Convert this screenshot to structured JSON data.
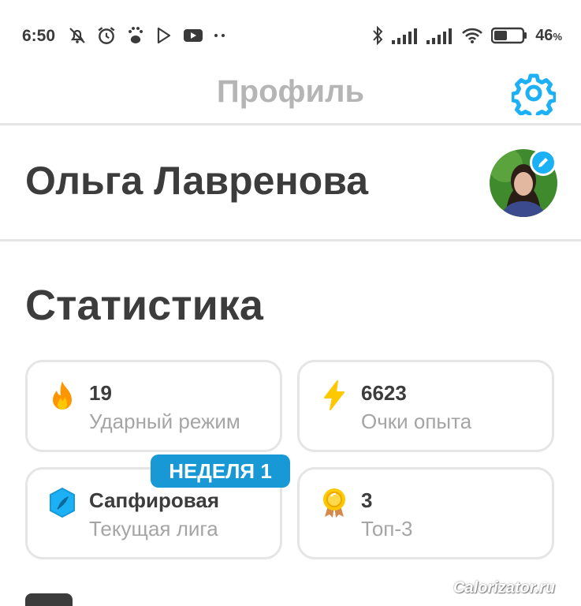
{
  "status_bar": {
    "time": "6:50",
    "battery_percent": "46",
    "battery_unit": "%",
    "battery_level": 0.46,
    "left_icons": [
      "muted-bell-icon",
      "alarm-icon",
      "paw-icon",
      "play-store-icon",
      "youtube-icon",
      "more-dots-icon"
    ],
    "right_icons": [
      "bluetooth-icon",
      "signal-icon",
      "signal-icon",
      "wifi-icon",
      "battery-icon"
    ]
  },
  "header": {
    "title": "Профиль",
    "settings_icon": "gear-icon"
  },
  "profile": {
    "name": "Ольга Лавренова",
    "avatar_icon": "avatar",
    "edit_icon": "pencil-icon"
  },
  "stats": {
    "title": "Статистика",
    "cards": [
      {
        "value": "19",
        "label": "Ударный режим",
        "icon": "flame-icon"
      },
      {
        "value": "6623",
        "label": "Очки опыта",
        "icon": "lightning-icon"
      },
      {
        "value": "Сапфировая",
        "label": "Текущая лига",
        "icon": "sapphire-league-icon",
        "badge": "НЕДЕЛЯ 1"
      },
      {
        "value": "3",
        "label": "Топ-3",
        "icon": "medal-icon"
      }
    ]
  },
  "watermark": "Calorizator.ru",
  "colors": {
    "accent_blue": "#1cb0f6",
    "badge_blue": "#1899d6",
    "text_dark": "#3c3c3c",
    "text_gray": "#a5a5a5",
    "border": "#e5e5e5",
    "flame": "#ff9600",
    "lightning": "#ffc800"
  }
}
